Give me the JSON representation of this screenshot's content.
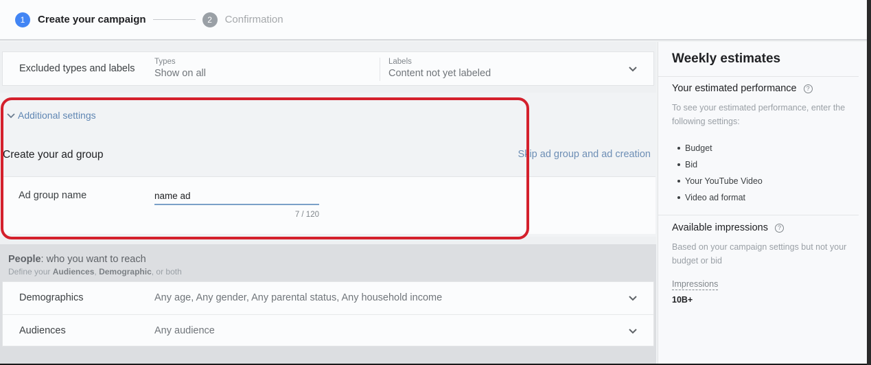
{
  "stepper": {
    "steps": [
      {
        "number": "1",
        "label": "Create your campaign",
        "state": "active"
      },
      {
        "number": "2",
        "label": "Confirmation",
        "state": "inactive"
      }
    ]
  },
  "excluded": {
    "label": "Excluded types and labels",
    "types_label": "Types",
    "types_value": "Show on all",
    "labels_label": "Labels",
    "labels_value": "Content not yet labeled"
  },
  "additional": {
    "toggle_label": "Additional settings",
    "ad_group_title": "Create your ad group",
    "skip_link": "Skip ad group and ad creation",
    "ad_group_name_label": "Ad group name",
    "ad_group_name_value": "name ad",
    "char_counter": "7 / 120"
  },
  "people": {
    "title_bold": "People",
    "title_rest": ": who you want to reach",
    "sub_prefix": "Define your ",
    "sub_bold_1": "Audiences",
    "sub_sep": ", ",
    "sub_bold_2": "Demographic",
    "sub_suffix": ", or both",
    "rows": [
      {
        "label": "Demographics",
        "value": "Any age, Any gender, Any parental status, Any household income"
      },
      {
        "label": "Audiences",
        "value": "Any audience"
      }
    ]
  },
  "side": {
    "title": "Weekly estimates",
    "performance_heading": "Your estimated performance",
    "performance_text": "To see your estimated performance, enter the following settings:",
    "settings": [
      "Budget",
      "Bid",
      "Your YouTube Video",
      "Video ad format"
    ],
    "impressions_heading": "Available impressions",
    "impressions_text": "Based on your campaign settings but not your budget or bid",
    "impressions_label": "Impressions",
    "impressions_value": "10B+",
    "help_glyph": "?"
  },
  "colors": {
    "accent": "#4285f4",
    "link": "#5f86b3",
    "highlight": "#d4202c"
  }
}
